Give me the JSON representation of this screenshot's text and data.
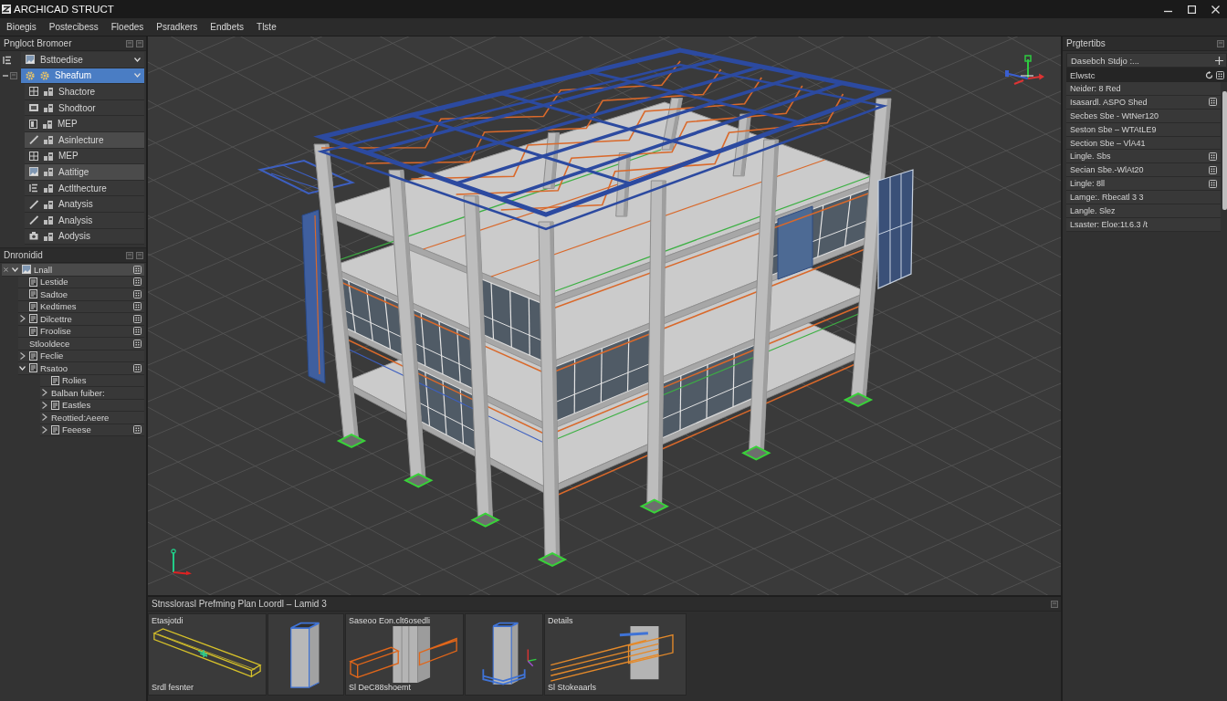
{
  "window": {
    "title": "ARCHICAD STRUCT"
  },
  "menu": [
    "Bioegis",
    "Postecibess",
    "Floedes",
    "Psradkers",
    "Endbets",
    "Tlste"
  ],
  "project_browser": {
    "title": "Pngloct Bromoer",
    "items": [
      {
        "label": "Bsttoedise",
        "selected": false,
        "highlighted": false
      },
      {
        "label": "Sheafum",
        "selected": true,
        "highlighted": false,
        "expanded": true,
        "children": [
          {
            "label": "Shactore",
            "selected": false,
            "highlighted": false
          },
          {
            "label": "Shodtoor",
            "selected": false,
            "highlighted": false
          },
          {
            "label": "MEP",
            "selected": false,
            "highlighted": false
          },
          {
            "label": "Asinlecture",
            "selected": false,
            "highlighted": true
          },
          {
            "label": "MEP",
            "selected": false,
            "highlighted": false
          },
          {
            "label": "Aatitige",
            "selected": false,
            "highlighted": true
          },
          {
            "label": "Actlthecture",
            "selected": false,
            "highlighted": false
          },
          {
            "label": "Anatysis",
            "selected": false,
            "highlighted": false
          },
          {
            "label": "Analysis",
            "selected": false,
            "highlighted": false
          },
          {
            "label": "Aodysis",
            "selected": false,
            "highlighted": false
          }
        ]
      }
    ]
  },
  "tree_panel": {
    "title": "Dnronidid",
    "items": [
      {
        "label": "Lnall",
        "kind": "image",
        "selected": true,
        "marked": true,
        "expanded": true,
        "children": [
          {
            "label": "Lestide",
            "kind": "sheet",
            "selected": false,
            "marked": true
          },
          {
            "label": "Sadtoe",
            "kind": "sheet",
            "selected": false,
            "marked": true
          },
          {
            "label": "Kedtimes",
            "kind": "sheet",
            "selected": false,
            "marked": true
          },
          {
            "label": "Dilcettre",
            "kind": "sheet",
            "selected": false,
            "marked": true,
            "expanded": false
          },
          {
            "label": "Froolise",
            "kind": "sheet",
            "selected": false,
            "marked": true
          },
          {
            "label": "Stlooldece",
            "kind": "text",
            "selected": false,
            "marked": true
          },
          {
            "label": "Feclie",
            "kind": "sheet",
            "selected": false,
            "marked": false,
            "expanded": false
          },
          {
            "label": "Rsatoo",
            "kind": "sheet",
            "selected": false,
            "marked": true,
            "expanded": true,
            "children": [
              {
                "label": "Rolies",
                "kind": "sheet",
                "selected": false,
                "marked": false
              },
              {
                "label": "Balban fuiber:",
                "kind": "text",
                "selected": false,
                "marked": false,
                "expanded": false
              },
              {
                "label": "Eastles",
                "kind": "sheet",
                "selected": false,
                "marked": false,
                "expanded": false
              },
              {
                "label": "Reottied:Aeere",
                "kind": "text",
                "selected": false,
                "marked": false,
                "expanded": false
              },
              {
                "label": "Feeese",
                "kind": "sheet",
                "selected": false,
                "marked": true,
                "expanded": false
              }
            ]
          }
        ]
      }
    ]
  },
  "thumbnail_panel": {
    "title": "Stnsslorasl Prefming Plan Loordl – Lamid 3",
    "thumbnails": [
      {
        "kind": "beam",
        "title": "Etasjotdi",
        "caption": "Srdl fesnter"
      },
      {
        "kind": "column"
      },
      {
        "kind": "joint",
        "title": "Saseoo Eon.clt6osedli",
        "caption": "Sl DeC88shoemt"
      },
      {
        "kind": "base"
      },
      {
        "kind": "connection",
        "title": "Details",
        "caption": "Sl Stokeaarls"
      }
    ]
  },
  "properties": {
    "title": "Prgtertibs",
    "style_field": "Dasebch Stdjo :...",
    "section": "Elwstc",
    "rows": [
      {
        "label": "Neider: 8 Red",
        "marked": false
      },
      {
        "label": "Isasardl. ASPO Shed",
        "marked": true
      },
      {
        "label": "Secbes Sbe - WtNer120",
        "marked": false
      },
      {
        "label": "Seston Sbe – WTAtLE9",
        "marked": false
      },
      {
        "label": "Section Sbe – VlA41",
        "marked": false
      },
      {
        "label": "Lingle. Sbs",
        "marked": true
      },
      {
        "label": "Secian Sbe.-WlAt20",
        "marked": true
      },
      {
        "label": "Lingle: 8ll",
        "marked": true
      },
      {
        "label": "Lamge:. Rbecatl 3 3",
        "marked": false
      },
      {
        "label": "Langle. Slez",
        "marked": false
      },
      {
        "label": "Lsaster: Eloe:1t.6.3 /t",
        "marked": false
      }
    ]
  }
}
